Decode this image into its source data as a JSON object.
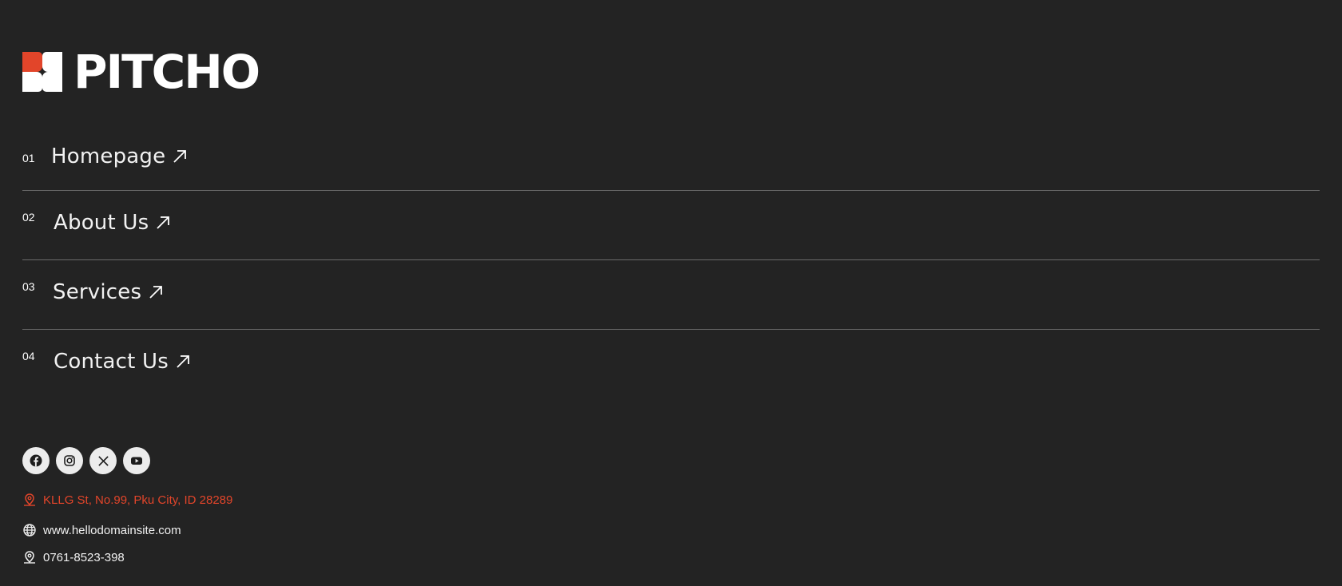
{
  "brand": {
    "name": "PITCHO",
    "accent": "#e2452a"
  },
  "nav": [
    {
      "num": "01",
      "label": "Homepage"
    },
    {
      "num": "02",
      "label": "About Us"
    },
    {
      "num": "03",
      "label": "Services"
    },
    {
      "num": "04",
      "label": "Contact Us"
    }
  ],
  "socials": [
    "facebook-icon",
    "instagram-icon",
    "x-icon",
    "youtube-icon"
  ],
  "contact": {
    "address": "KLLG St, No.99, Pku City, ID 28289",
    "website": "www.hellodomainsite.com",
    "phone": "0761-8523-398"
  }
}
